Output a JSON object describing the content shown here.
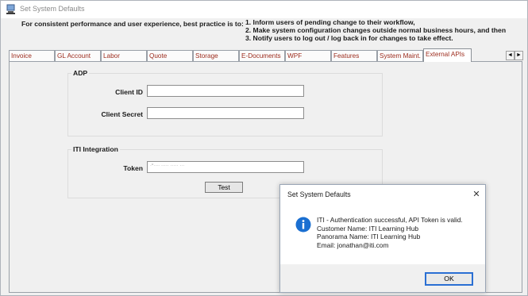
{
  "window": {
    "title": "Set System Defaults"
  },
  "notice": {
    "lead": "For consistent performance and user experience, best practice is to:",
    "steps": [
      "1. Inform users of pending change to their workflow,",
      "2. Make system configuration changes outside normal business hours, and then",
      "3. Notify users to log out / log back in for changes to take effect."
    ]
  },
  "tabs": [
    {
      "label": "Invoice",
      "active": false
    },
    {
      "label": "GL Account",
      "active": false
    },
    {
      "label": "Labor",
      "active": false
    },
    {
      "label": "Quote",
      "active": false
    },
    {
      "label": "Storage",
      "active": false
    },
    {
      "label": "E-Documents",
      "active": false
    },
    {
      "label": "WPF",
      "active": false
    },
    {
      "label": "Features",
      "active": false
    },
    {
      "label": "System Maint.",
      "active": false
    },
    {
      "label": "External APIs",
      "active": true
    }
  ],
  "tab_scroll": {
    "left": "◄",
    "right": "►"
  },
  "adp": {
    "title": "ADP",
    "client_id_label": "Client ID",
    "client_id_value": "",
    "client_secret_label": "Client Secret",
    "client_secret_value": ""
  },
  "iti": {
    "title": "ITI Integration",
    "token_label": "Token",
    "token_value": "ˑ˘ˑˑˑˑ ˑˑˑˑˑ ˑˑˑˑˑ ˑˑˑ",
    "test_label": "Test"
  },
  "dialog": {
    "title": "Set System Defaults",
    "close_glyph": "✕",
    "icon": "info-icon",
    "lines": [
      "ITI - Authentication successful, API Token is valid.",
      "Customer Name: ITI Learning Hub",
      "Panorama Name: ITI Learning Hub",
      "Email: jonathan@iti.com"
    ],
    "ok_label": "OK"
  }
}
